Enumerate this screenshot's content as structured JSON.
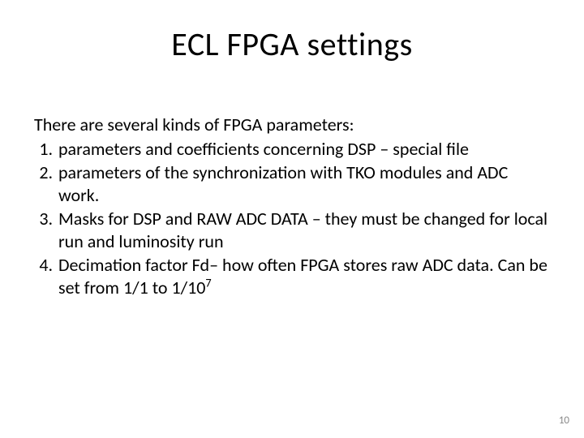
{
  "title": "ECL FPGA settings",
  "intro": "There are several kinds of FPGA parameters:",
  "items": [
    "parameters and coefficients concerning DSP – special file",
    "parameters of the synchronization with TKO modules and ADC work.",
    "Masks for DSP and RAW ADC DATA – they must be changed for local run and luminosity run",
    "Decimation factor Fd– how often FPGA stores raw ADC data. Can be set from 1/1 to 1/10"
  ],
  "exp": "7",
  "page": "10"
}
